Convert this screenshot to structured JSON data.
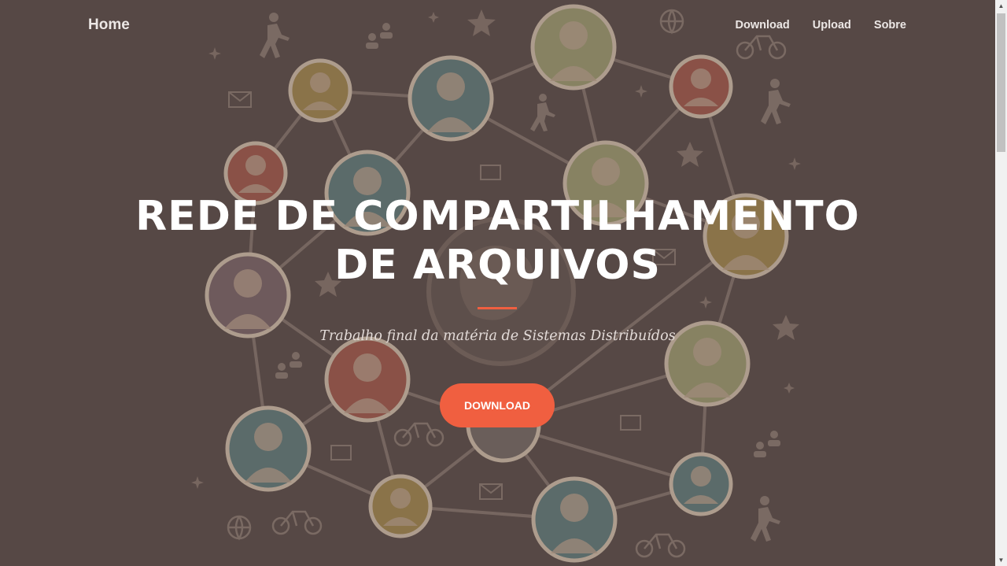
{
  "navbar": {
    "brand": "Home",
    "links": [
      "Download",
      "Upload",
      "Sobre"
    ]
  },
  "hero": {
    "title_line1": "REDE DE COMPARTILHAMENTO",
    "title_line2": "DE ARQUIVOS",
    "subtitle": "Trabalho final da matéria de Sistemas Distribuídos",
    "cta_label": "DOWNLOAD"
  },
  "colors": {
    "background": "#564845",
    "accent": "#f05f40",
    "text": "#ffffff"
  },
  "background_image": "social-network-people-icon",
  "scrollbar": {
    "up_icon": "arrow-up-icon",
    "down_icon": "arrow-down-icon"
  }
}
